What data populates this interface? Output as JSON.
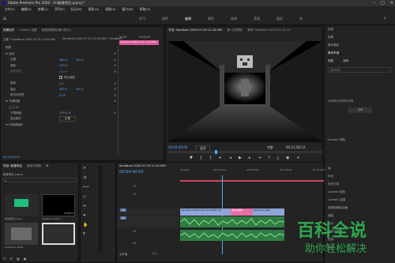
{
  "app": {
    "title": "Adobe Premiere Pro 2020 - H:\\新建项目.prproj *"
  },
  "menu": [
    "文件(F)",
    "编辑(E)",
    "剪辑(C)",
    "序列(S)",
    "标记(M)",
    "图形(G)",
    "视图(V)",
    "窗口(W)",
    "帮助(H)"
  ],
  "workspaces": [
    "学习",
    "组件",
    "编辑",
    "颜色",
    "效果",
    "音频",
    "图形",
    "库"
  ],
  "effect_controls": {
    "tabs": [
      "效果控件",
      "Lumetri 范围",
      "音频剪辑混合器: 镜头A",
      "元数据"
    ],
    "source_label": "主要 * Sandbum 2020-07-24 12-43-063",
    "seq_label": "Sandbum 2020-07-24 12-43-063 * Sandbum",
    "timecode_start": "00;00",
    "timecode_end": "00;00;05",
    "clip_chip": "Sandbum 2020-07-24 12-43-063",
    "sections": [
      "视频",
      "fx 运动",
      "位置",
      "缩放",
      "缩放宽度",
      "旋转",
      "锚点",
      "防闪烁滤镜",
      "fx 不透明度",
      "不透明度",
      "混合模式",
      "fx 时间重映射"
    ],
    "values": {
      "pos_x": "960.0",
      "pos_y": "540.0",
      "scale": "100.0",
      "scale_w": "100.0",
      "uniform_label": "等比缩放",
      "rotation": "0.0",
      "anchor_x": "960.0",
      "anchor_y": "540.0",
      "flicker": "0.00",
      "opacity": "100.0 %",
      "blend": "正常"
    },
    "footer_time": "00;04;40;00"
  },
  "program_monitor": {
    "tabs": [
      "节目: Sandbum 2020-07-24 12-43-063",
      "源: (无剪辑)",
      "参考: Sandbum 2020-07-24 12"
    ],
    "timecode": "00;04;40;00",
    "fit": "适合",
    "quality": "完整",
    "duration": "00;12;58;12"
  },
  "right_panel": {
    "items": [
      "信息",
      "效果",
      "基本图形",
      "基本声音",
      "Lumetri 颜色",
      "库",
      "标记",
      "历史记录",
      "Lumetri 颜色",
      "Lumetri 范围",
      "音频剪辑混合器",
      "捕捉",
      "标记",
      "历史记录",
      "信息",
      "变换"
    ],
    "search_placeholder": "选择剪辑",
    "browse": "浏览",
    "edit": "编辑",
    "caption": "添加轨道",
    "sub": "选择具有音频的剪辑",
    "badge": "自动"
  },
  "project": {
    "tabs": [
      "项目: 新建项目",
      "媒体浏览器",
      "库"
    ],
    "path": "新建项目.prproj",
    "items": [
      {
        "name": "新建项目.prproj",
        "dur": ""
      },
      {
        "name": "Sandbum 2020-...",
        "dur": "12;58;12"
      },
      {
        "name": "Sandbum 2020...",
        "dur": "12;58;12"
      }
    ]
  },
  "timeline": {
    "title": "Sandbum 2020-07-24 12-43-063",
    "timecode": "00;04;40;00",
    "ruler": [
      "00;00;00",
      "00;04;00;00",
      "00;08;00;00",
      "00;12;00;00",
      "00;16;00;00"
    ],
    "tracks": [
      "V3",
      "V2",
      "V1",
      "A1",
      "A2",
      "A3"
    ],
    "clips": [
      {
        "label": "Sandbum 2020-07-24 12-43-063 [V]",
        "track": "V1"
      },
      {
        "label": "设为主题嵌",
        "track": "V1"
      },
      {
        "label": "Sandbum 2020",
        "track": "V1"
      }
    ],
    "master": "主声道",
    "master_val": "0.0"
  },
  "watermark": {
    "title": "百科全说",
    "sub": "助你轻松解决"
  }
}
